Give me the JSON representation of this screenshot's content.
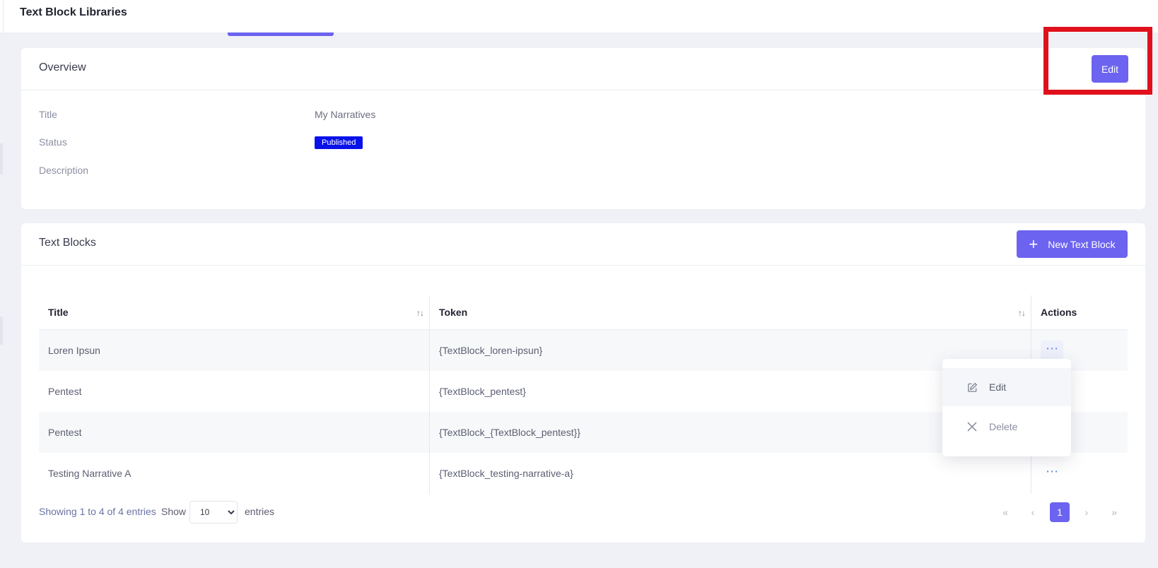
{
  "header": {
    "title": "Text Block Libraries"
  },
  "overview": {
    "heading": "Overview",
    "edit_label": "Edit",
    "fields": [
      {
        "label": "Title",
        "value": "My Narratives"
      },
      {
        "label": "Status",
        "value": "Published"
      },
      {
        "label": "Description",
        "value": ""
      }
    ],
    "status_color": "#0a12ea"
  },
  "text_blocks": {
    "heading": "Text Blocks",
    "new_button_label": "New Text Block",
    "columns": [
      "Title",
      "Token",
      "Actions"
    ],
    "rows": [
      {
        "title": "Loren Ipsun",
        "token": "{TextBlock_loren-ipsun}"
      },
      {
        "title": "Pentest",
        "token": "{TextBlock_pentest}"
      },
      {
        "title": "Pentest",
        "token": "{TextBlock_{TextBlock_pentest}}"
      },
      {
        "title": "Testing Narrative A",
        "token": "{TextBlock_testing-narrative-a}"
      }
    ],
    "actions_menu": [
      {
        "label": "Edit",
        "icon": "edit-icon"
      },
      {
        "label": "Delete",
        "icon": "close-icon"
      }
    ]
  },
  "footer": {
    "showing_text": "Showing 1 to 4 of 4 entries",
    "show_label": "Show",
    "page_size": "10",
    "entries_label": "entries",
    "current_page": "1"
  },
  "colors": {
    "accent": "#6c63f0",
    "highlight": "#e0101c"
  }
}
